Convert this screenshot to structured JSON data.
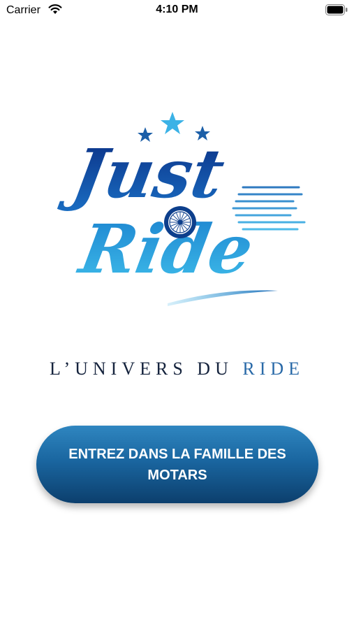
{
  "status_bar": {
    "carrier": "Carrier",
    "time": "4:10 PM",
    "wifi_icon": "wifi-icon",
    "battery_icon": "battery-icon"
  },
  "logo": {
    "line1": "Just",
    "line2": "Ride",
    "icon": "motorcycle-wheel-icon",
    "colors": {
      "dark": "#0d3f8c",
      "light": "#3bb2e6"
    }
  },
  "tagline": {
    "part1": "L’UNIVERS DU",
    "part2": "RIDE"
  },
  "cta": {
    "label": "ENTREZ DANS LA FAMILLE DES MOTARS",
    "color_top": "#2f86c0",
    "color_bottom": "#0c3f6d"
  }
}
